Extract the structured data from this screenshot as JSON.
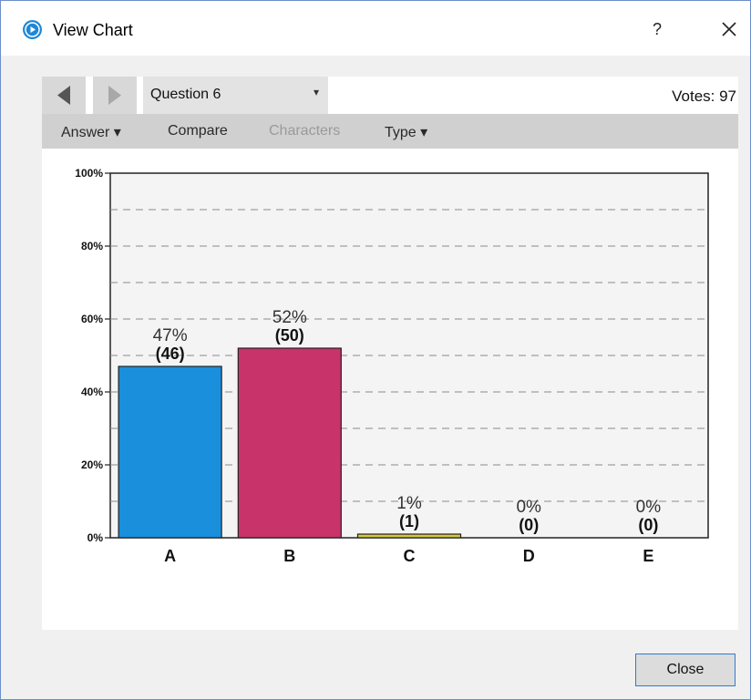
{
  "window": {
    "title": "View Chart",
    "help_label": "?",
    "app_icon": "play-circle-icon",
    "close_icon": "close-icon"
  },
  "toolbar": {
    "prev_icon": "triangle-left-icon",
    "next_icon": "triangle-right-icon",
    "question_select": "Question 6",
    "question_arrow": "▾",
    "votes": "Votes: 97"
  },
  "menu": {
    "answer": "Answer ▾",
    "compare": "Compare",
    "characters": "Characters",
    "type": "Type ▾"
  },
  "chart_data": {
    "type": "bar",
    "categories": [
      "A",
      "B",
      "C",
      "D",
      "E"
    ],
    "values": [
      47,
      52,
      1,
      0,
      0
    ],
    "counts": [
      46,
      50,
      1,
      0,
      0
    ],
    "percent_labels": [
      "47%",
      "52%",
      "1%",
      "0%",
      "0%"
    ],
    "count_labels": [
      "(46)",
      "(50)",
      "(1)",
      "(0)",
      "(0)"
    ],
    "colors": [
      "#1a8fdc",
      "#c8336a",
      "#d3c93b",
      "#cccccc",
      "#cccccc"
    ],
    "yticks": [
      "0%",
      "20%",
      "40%",
      "60%",
      "80%",
      "100%"
    ],
    "ylim": [
      0,
      100
    ],
    "grid": true
  },
  "footer": {
    "close_label": "Close"
  }
}
